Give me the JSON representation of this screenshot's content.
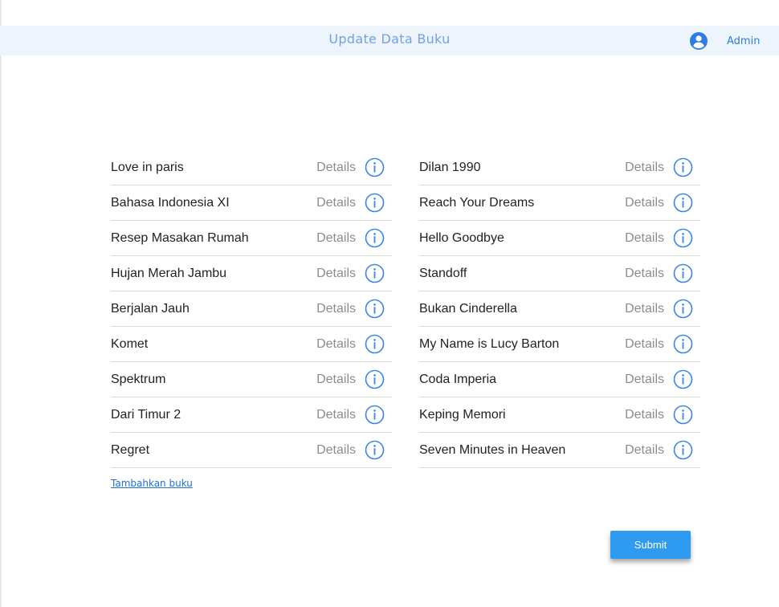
{
  "header": {
    "title": "Update Data Buku",
    "user_label": "Admin",
    "user_icon": "account-circle-icon"
  },
  "books": {
    "left": [
      {
        "title": "Love in paris",
        "action": "Details"
      },
      {
        "title": "Bahasa Indonesia XI",
        "action": "Details"
      },
      {
        "title": "Resep Masakan Rumah",
        "action": "Details"
      },
      {
        "title": "Hujan Merah Jambu",
        "action": "Details"
      },
      {
        "title": "Berjalan Jauh",
        "action": "Details"
      },
      {
        "title": "Komet",
        "action": "Details"
      },
      {
        "title": "Spektrum",
        "action": "Details"
      },
      {
        "title": "Dari Timur 2",
        "action": "Details"
      },
      {
        "title": "Regret",
        "action": "Details"
      }
    ],
    "right": [
      {
        "title": "Dilan 1990",
        "action": "Details"
      },
      {
        "title": "Reach Your Dreams",
        "action": "Details"
      },
      {
        "title": "Hello Goodbye",
        "action": "Details"
      },
      {
        "title": "Standoff",
        "action": "Details"
      },
      {
        "title": "Bukan Cinderella",
        "action": "Details"
      },
      {
        "title": "My Name is Lucy Barton",
        "action": "Details"
      },
      {
        "title": "Coda Imperia",
        "action": "Details"
      },
      {
        "title": "Keping Memori",
        "action": "Details"
      },
      {
        "title": "Seven Minutes in Heaven",
        "action": "Details"
      }
    ]
  },
  "add_book_link": "Tambahkan buku",
  "submit_label": "Submit",
  "colors": {
    "header_bg": "#eef4fb",
    "accent": "#2f7de0",
    "button": "#2f9bf0",
    "info_icon": "#3a86e6"
  }
}
